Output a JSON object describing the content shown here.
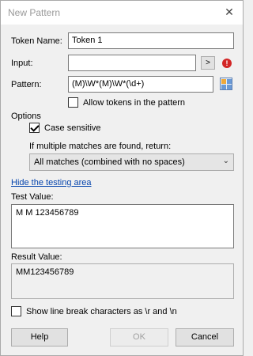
{
  "window": {
    "title": "New Pattern",
    "close_glyph": "✕"
  },
  "form": {
    "token_name_label": "Token Name:",
    "token_name_value": "Token 1",
    "input_label": "Input:",
    "input_value": "",
    "input_button_label": ">",
    "error_icon_glyph": "!",
    "pattern_label": "Pattern:",
    "pattern_value": "(M)\\W*(M)\\W*(\\d+)",
    "allow_tokens_label": "Allow tokens in the pattern",
    "allow_tokens_checked": false
  },
  "options": {
    "heading": "Options",
    "case_sensitive_label": "Case sensitive",
    "case_sensitive_checked": true,
    "multiple_matches_label": "If multiple matches are found, return:",
    "multiple_matches_selected": "All matches (combined with no spaces)",
    "combo_arrow": "⌄"
  },
  "testing": {
    "hide_link": "Hide the testing area",
    "test_value_label": "Test Value:",
    "test_value": "M M 123456789",
    "result_value_label": "Result Value:",
    "result_value": "MM123456789",
    "show_line_break_label": "Show line break characters as \\r and \\n",
    "show_line_break_checked": false
  },
  "buttons": {
    "help": "Help",
    "ok": "OK",
    "cancel": "Cancel"
  },
  "colors": {
    "accent_link": "#0645ad",
    "error": "#d22626"
  }
}
